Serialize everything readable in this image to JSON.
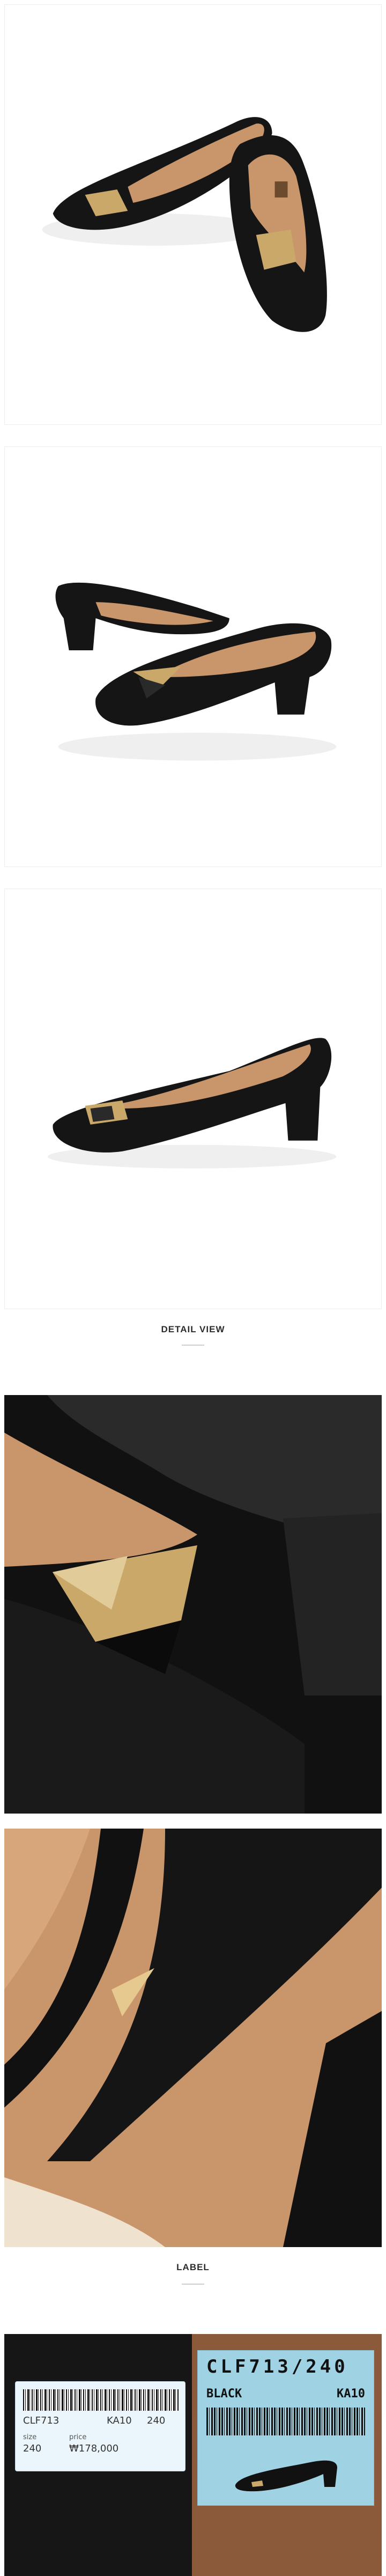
{
  "sections": {
    "detail_title": "DETAIL VIEW",
    "label_title": "LABEL"
  },
  "label": {
    "left_tag": {
      "code_line": "CLF713",
      "sub_code": "KA10",
      "sub_size": "240",
      "size_label": "size",
      "size_value": "240",
      "price_label": "price",
      "price_value": "₩178,000"
    },
    "right_tag": {
      "code": "CLF713/240",
      "color": "BLACK",
      "sub_code": "KA10"
    }
  },
  "colors": {
    "leather": "#151515",
    "lining": "#c9956a",
    "gold": "#c9a86a"
  }
}
